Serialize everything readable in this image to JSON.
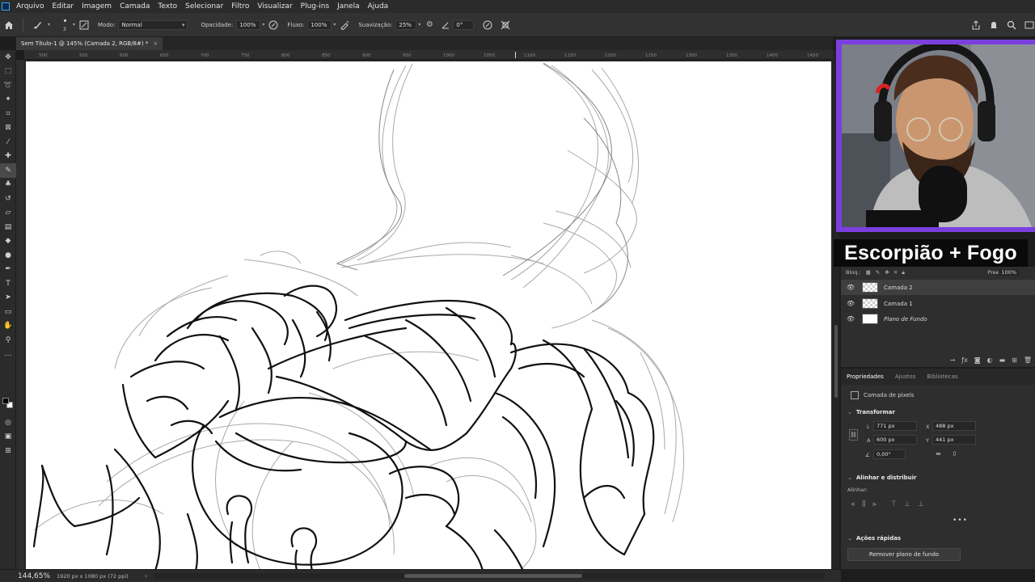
{
  "menubar": {
    "items": [
      "Arquivo",
      "Editar",
      "Imagem",
      "Camada",
      "Texto",
      "Selecionar",
      "Filtro",
      "Visualizar",
      "Plug-ins",
      "Janela",
      "Ajuda"
    ]
  },
  "options": {
    "brush_size": "3",
    "mode_label": "Modo:",
    "mode_value": "Normal",
    "opacity_label": "Opacidade:",
    "opacity_value": "100%",
    "flow_label": "Fluxo:",
    "flow_value": "100%",
    "smoothing_label": "Suavização:",
    "smoothing_value": "25%",
    "angle_value": "0°"
  },
  "document": {
    "tab_title": "Sem Título-1 @ 145% (Camada 2, RGB/8#) *",
    "close_glyph": "×"
  },
  "ruler": {
    "ticks": [
      "500",
      "550",
      "600",
      "650",
      "700",
      "750",
      "800",
      "850",
      "900",
      "950",
      "1000",
      "1050",
      "1100",
      "1150",
      "1200",
      "1250",
      "1300",
      "1350",
      "1400",
      "1450"
    ]
  },
  "status": {
    "zoom": "144,65%",
    "doc_size": "1920 px x 1080 px (72 ppi)",
    "arrow": "›"
  },
  "stream": {
    "overlay_title": "Escorpião + Fogo"
  },
  "layers": {
    "lock_label": "Bloq.:",
    "fill_label": "Preen.:",
    "fill_value": "100%",
    "items": [
      {
        "name": "Camada 2",
        "selected": true
      },
      {
        "name": "Camada 1",
        "selected": false
      },
      {
        "name": "Plano de Fundo",
        "selected": false
      }
    ]
  },
  "properties": {
    "tabs": [
      "Propriedades",
      "Ajustes",
      "Bibliotecas"
    ],
    "pixel_layer_label": "Camada de pixels",
    "transform_title": "Transformar",
    "width_label": "L",
    "width_value": "771 px",
    "height_label": "A",
    "height_value": "600 px",
    "x_label": "X",
    "x_value": "488 px",
    "y_label": "Y",
    "y_value": "441 px",
    "angle_value": "0,00°",
    "align_title": "Alinhar e distribuir",
    "align_label": "Alinhar:",
    "quick_actions_title": "Ações rápidas",
    "remove_bg_label": "Remover plano de fundo",
    "more": "•••"
  },
  "colors": {
    "app_bg": "#1d1d1d",
    "panel_bg": "#2e2e2e",
    "webcam_border": "#7b3fe0",
    "overlay_bg": "#0a0a0a",
    "canvas": "#ffffff"
  }
}
